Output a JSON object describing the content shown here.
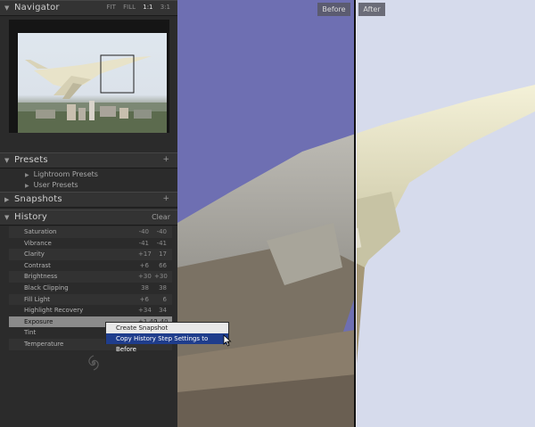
{
  "navigator": {
    "title": "Navigator",
    "zoom_options": [
      "FIT",
      "FILL",
      "1:1",
      "3:1"
    ],
    "selected_zoom": "1:1"
  },
  "presets": {
    "title": "Presets",
    "add_label": "+",
    "items": [
      "Lightroom Presets",
      "User Presets"
    ]
  },
  "snapshots": {
    "title": "Snapshots",
    "add_label": "+"
  },
  "history": {
    "title": "History",
    "clear_label": "Clear",
    "items": [
      {
        "label": "Saturation",
        "from": "-40",
        "to": "-40"
      },
      {
        "label": "Vibrance",
        "from": "-41",
        "to": "-41"
      },
      {
        "label": "Clarity",
        "from": "+17",
        "to": "17"
      },
      {
        "label": "Contrast",
        "from": "+6",
        "to": "66"
      },
      {
        "label": "Brightness",
        "from": "+30",
        "to": "+30"
      },
      {
        "label": "Black Clipping",
        "from": "38",
        "to": "38"
      },
      {
        "label": "Fill Light",
        "from": "+6",
        "to": "6"
      },
      {
        "label": "Highlight Recovery",
        "from": "+34",
        "to": "34"
      },
      {
        "label": "Exposure",
        "from": "+1.40",
        "to": "1.40"
      },
      {
        "label": "Tint",
        "from": "",
        "to": ""
      },
      {
        "label": "Temperature",
        "from": "",
        "to": ""
      }
    ],
    "selected_index": 8
  },
  "context_menu": {
    "items": [
      "Create Snapshot",
      "Copy History Step Settings to Before"
    ],
    "highlighted_index": 1
  },
  "view": {
    "before_label": "Before",
    "after_label": "After"
  },
  "colors": {
    "panel_bg": "#2b2b2b",
    "panel_header": "#333333",
    "history_selected": "#8b8b8b",
    "menu_highlight": "#1f3d8c",
    "before_sky": "#6e6fb2",
    "after_sky": "#d6dbec"
  },
  "icons": [
    "disclosure-triangle-icon",
    "plus-icon",
    "panel-end-ornament-icon",
    "arrow-cursor-icon"
  ]
}
